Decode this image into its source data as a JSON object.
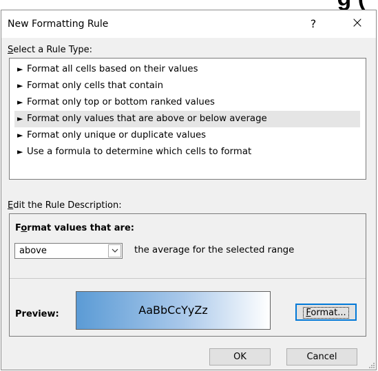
{
  "background_fragment": "g (",
  "dialog": {
    "title": "New Formatting Rule",
    "help_label": "?",
    "close_label": "×"
  },
  "rule_type": {
    "label_accel": "S",
    "label_rest": "elect a Rule Type:",
    "items": [
      {
        "label": "Format all cells based on their values",
        "selected": false
      },
      {
        "label": "Format only cells that contain",
        "selected": false
      },
      {
        "label": "Format only top or bottom ranked values",
        "selected": false
      },
      {
        "label": "Format only values that are above or below average",
        "selected": true
      },
      {
        "label": "Format only unique or duplicate values",
        "selected": false
      },
      {
        "label": "Use a formula to determine which cells to format",
        "selected": false
      }
    ],
    "arrow_glyph": "►"
  },
  "description": {
    "label_accel": "E",
    "label_rest": "dit the Rule Description:",
    "format_label_pre": "F",
    "format_label_accel": "o",
    "format_label_post": "rmat values that are:",
    "select_value": "above",
    "range_text": "the average for the selected range",
    "preview_label": "Preview:",
    "preview_sample": "AaBbCcYyZz",
    "format_button_accel": "F",
    "format_button_rest": "ormat..."
  },
  "buttons": {
    "ok": "OK",
    "cancel": "Cancel"
  },
  "colors": {
    "dialog_bg": "#f0f0f0",
    "selected_row": "#e5e5e5",
    "preview_gradient_start": "#5b9bd5",
    "focus_border": "#0078d7"
  }
}
